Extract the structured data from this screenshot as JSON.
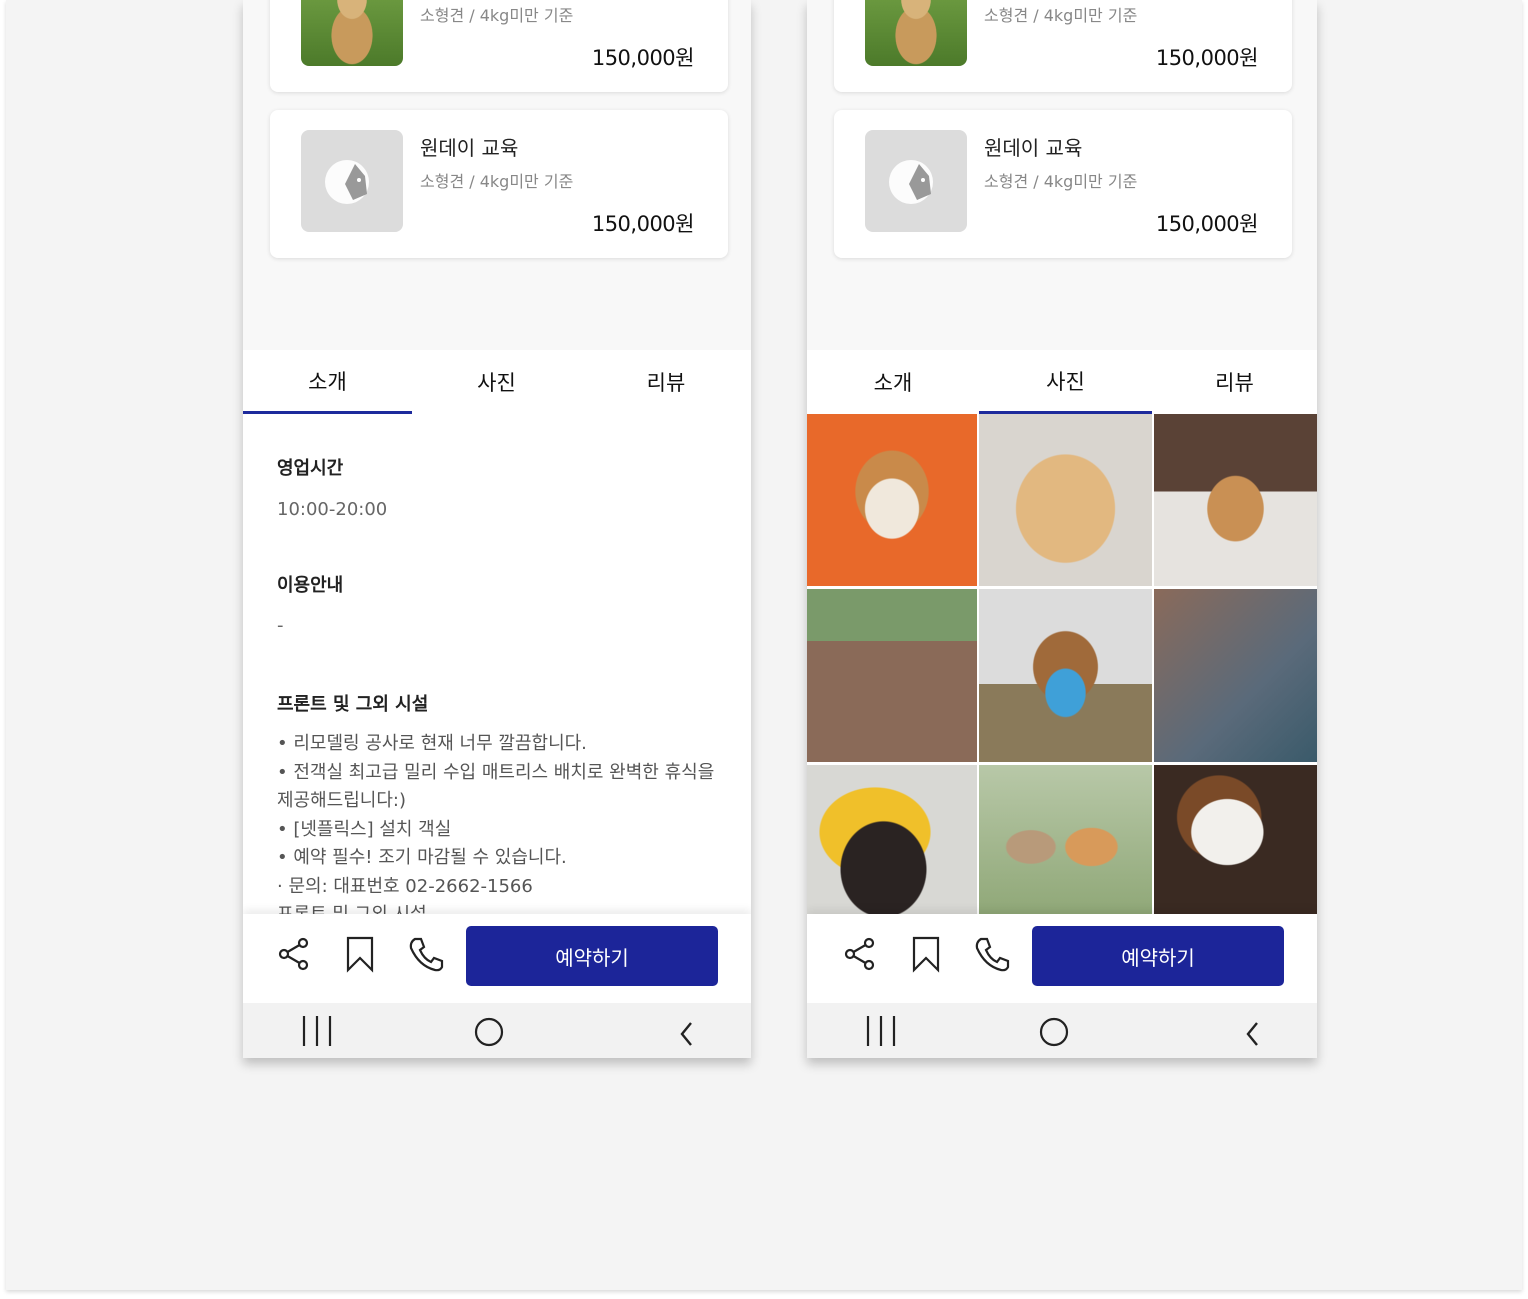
{
  "cards": [
    {
      "title": "",
      "subtitle": "소형견 / 4kg미만 기준",
      "price": "150,000원"
    },
    {
      "title": "원데이 교육",
      "subtitle": "소형견 / 4kg미만 기준",
      "price": "150,000원"
    }
  ],
  "tabs": [
    {
      "label": "소개"
    },
    {
      "label": "사진"
    },
    {
      "label": "리뷰"
    }
  ],
  "left_active_tab": "소개",
  "right_active_tab": "사진",
  "intro": {
    "hours_heading": "영업시간",
    "hours_value": "10:00-20:00",
    "usage_heading": "이용안내",
    "usage_value": "-",
    "facility_heading": "프론트 및 그외 시설",
    "facility_lines": [
      "• 리모델링 공사로 현재 너무 깔끔합니다.",
      "• 전객실 최고급 밀리 수입 매트리스 배치로 완벽한 휴식을",
      "제공해드립니다:)",
      "• [넷플릭스] 설치 객실",
      "• 예약 필수! 조기 마감될 수 있습니다.",
      " · 문의: 대표번호 02-2662-1566",
      "프론트 및 그외 시설"
    ]
  },
  "actions": {
    "book_label": "예약하기",
    "icons": [
      "share-icon",
      "bookmark-icon",
      "phone-icon"
    ]
  },
  "navbar_icons": [
    "recent-apps-icon",
    "home-icon",
    "back-icon"
  ],
  "colors": {
    "accent": "#1c2599",
    "tab_underline": "#1d2a9c",
    "background": "#f4f4f4"
  }
}
